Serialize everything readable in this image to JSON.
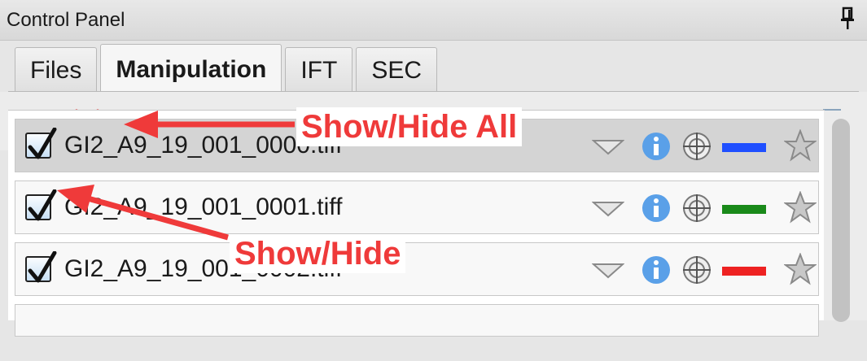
{
  "window": {
    "title": "Control Panel",
    "pin_icon": "pin-icon"
  },
  "tabs": [
    {
      "label": "Files",
      "active": false
    },
    {
      "label": "Manipulation",
      "active": true
    },
    {
      "label": "IFT",
      "active": false
    },
    {
      "label": "SEC",
      "active": false
    }
  ],
  "toolbar": {
    "show_all_icon": "eye-icon",
    "hide_all_icon": "eye-crossed-icon",
    "move_up_icon": "arrow-up-icon",
    "move_down_icon": "arrow-down-icon"
  },
  "files": [
    {
      "name": "GI2_A9_19_001_0000.tiff",
      "checked": true,
      "selected": true,
      "color": "#1f4fff"
    },
    {
      "name": "GI2_A9_19_001_0001.tiff",
      "checked": true,
      "selected": false,
      "color": "#1a8a1a"
    },
    {
      "name": "GI2_A9_19_001_0002.tiff",
      "checked": true,
      "selected": false,
      "color": "#ee2222"
    }
  ],
  "annotations": {
    "show_hide_all": "Show/Hide All",
    "show_hide": "Show/Hide"
  },
  "colors": {
    "annotation": "#ef3a3a",
    "info": "#5aa0e8"
  }
}
